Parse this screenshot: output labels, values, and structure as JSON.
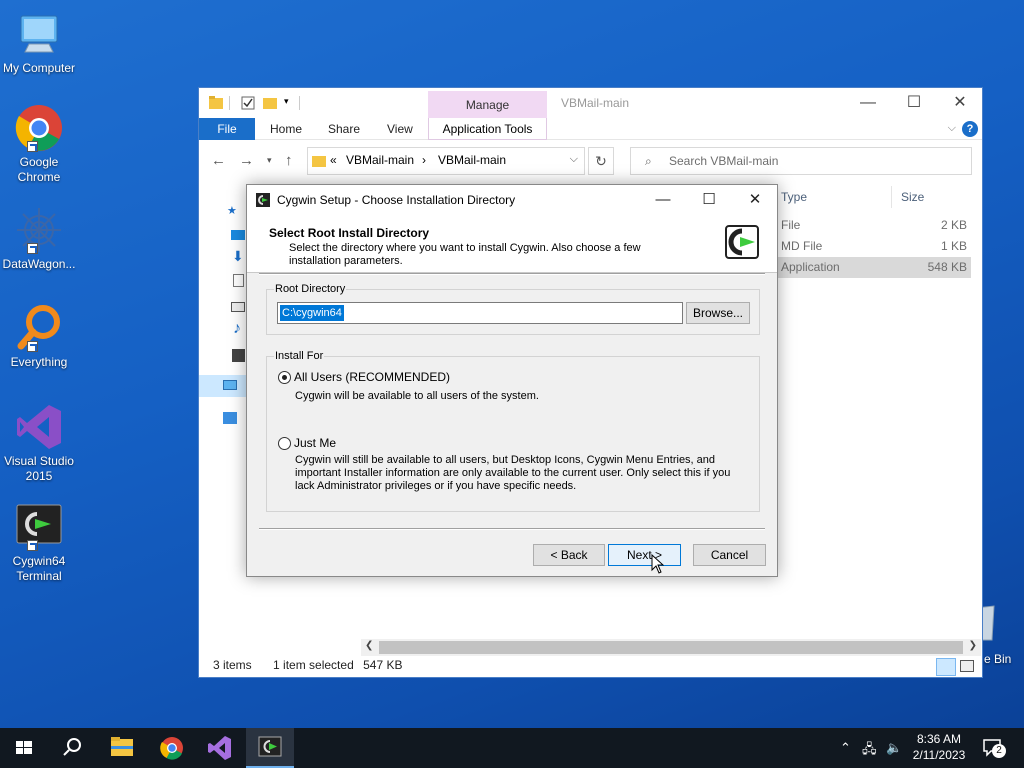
{
  "desktop": {
    "icons": [
      {
        "label": "My Computer"
      },
      {
        "label": "Google Chrome"
      },
      {
        "label": "DataWagon..."
      },
      {
        "label": "Everything"
      },
      {
        "label": "Visual Studio 2015"
      },
      {
        "label": "Cygwin64 Terminal"
      },
      {
        "label": "e Bin"
      }
    ]
  },
  "explorer": {
    "title": "VBMail-main",
    "manage_tab": "Manage",
    "ribbon_tabs": [
      "File",
      "Home",
      "Share",
      "View",
      "Application Tools"
    ],
    "help_icon": "?",
    "address": {
      "prefix": "«",
      "crumbs": [
        "VBMail-main",
        "VBMail-main"
      ]
    },
    "search_placeholder": "Search VBMail-main",
    "columns": {
      "type": "Type",
      "size": "Size"
    },
    "files": [
      {
        "type": "File",
        "size": "2 KB"
      },
      {
        "type": "MD File",
        "size": "1 KB"
      },
      {
        "type": "Application",
        "size": "548 KB"
      }
    ],
    "status": {
      "items": "3 items",
      "selected": "1 item selected",
      "size": "547 KB"
    }
  },
  "dialog": {
    "title": "Cygwin Setup - Choose Installation Directory",
    "heading": "Select Root Install Directory",
    "subheading": "Select the directory where you want to install Cygwin.  Also choose a few installation parameters.",
    "root_group_label": "Root Directory",
    "root_value": "C:\\cygwin64",
    "browse_label": "Browse...",
    "install_group_label": "Install For",
    "option_all_label": "All Users (RECOMMENDED)",
    "option_all_desc": "Cygwin will be available to all users of the system.",
    "option_me_label": "Just Me",
    "option_me_desc": "Cygwin will still be available to all users, but Desktop Icons, Cygwin Menu Entries, and important Installer information are only available to the current user.  Only select this if you lack Administrator privileges or if you have specific needs.",
    "back_label": "< Back",
    "next_label": "Next >",
    "cancel_label": "Cancel"
  },
  "taskbar": {
    "time": "8:36 AM",
    "date": "2/11/2023",
    "notification_count": "2"
  },
  "colors": {
    "accent": "#0078d7",
    "file_tab": "#1a6ec9",
    "manage_tab": "#f1d9f3",
    "taskbar": "#111820"
  }
}
